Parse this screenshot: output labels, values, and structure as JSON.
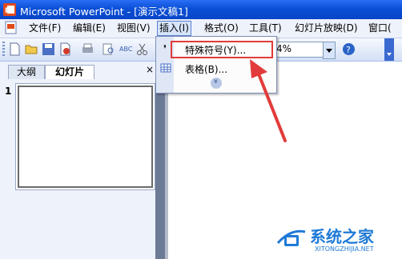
{
  "window": {
    "title": "Microsoft PowerPoint - [演示文稿1]"
  },
  "menubar": {
    "items": [
      {
        "label": "文件(F)"
      },
      {
        "label": "编辑(E)"
      },
      {
        "label": "视图(V)"
      },
      {
        "label": "插入(I)"
      },
      {
        "label": "格式(O)"
      },
      {
        "label": "工具(T)"
      },
      {
        "label": "幻灯片放映(D)"
      },
      {
        "label": "窗口("
      }
    ]
  },
  "toolbar": {
    "zoom_value": "4%"
  },
  "left_pane": {
    "tabs": [
      {
        "label": "大纲"
      },
      {
        "label": "幻灯片"
      }
    ],
    "close_glyph": "×",
    "slide_number": "1"
  },
  "insert_menu": {
    "items": [
      {
        "label": "特殊符号(Y)...",
        "icon": "special-symbol-icon"
      },
      {
        "label": "表格(B)...",
        "icon": "table-icon"
      }
    ],
    "expand_glyph": "»",
    "highlight_color": "#e23b3b"
  },
  "annotation": {
    "arrow_color": "#e23b3b"
  },
  "watermark": {
    "brand": "系统之家",
    "url": "XITONGZHIJIA.NET"
  }
}
